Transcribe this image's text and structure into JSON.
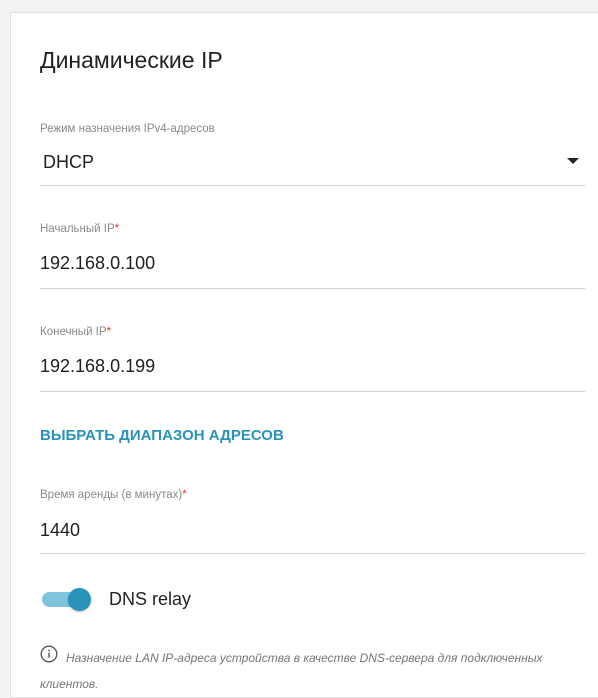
{
  "section": {
    "title": "Динамические IP"
  },
  "fields": {
    "mode": {
      "label": "Режим назначения IPv4-адресов",
      "value": "DHCP"
    },
    "start_ip": {
      "label": "Начальный IP",
      "required_mark": "*",
      "value": "192.168.0.100"
    },
    "end_ip": {
      "label": "Конечный IP",
      "required_mark": "*",
      "value": "192.168.0.199"
    },
    "lease": {
      "label": "Время аренды (в минутах)",
      "required_mark": "*",
      "value": "1440"
    }
  },
  "select_range_link": "ВЫБРАТЬ ДИАПАЗОН АДРЕСОВ",
  "dns_relay": {
    "label": "DNS relay",
    "enabled": true
  },
  "hint": {
    "icon": "info-icon",
    "text": "Назначение LAN IP-адреса устройства в качестве DNS-сервера для подключенных клиентов."
  },
  "colors": {
    "accent": "#2893b8",
    "toggle_track": "#7ec4dc",
    "required": "#e53935"
  }
}
